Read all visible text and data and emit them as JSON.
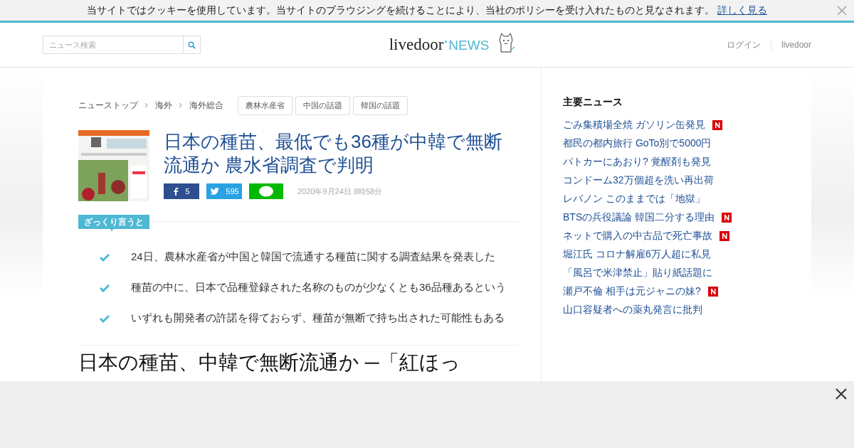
{
  "cookie_bar": {
    "message": "当サイトではクッキーを使用しています。当サイトのブラウジングを続けることにより、当社のポリシーを受け入れたものと見なされます。",
    "link": "詳しく見る"
  },
  "header": {
    "search": {
      "placeholder": "ニュース検索"
    },
    "logo": {
      "brand": "livedoor",
      "product": "NEWS"
    },
    "nav": [
      "ログイン",
      "livedoor"
    ]
  },
  "breadcrumb": [
    "ニューストップ",
    "海外",
    "海外総合"
  ],
  "tags": [
    "農林水産省",
    "中国の話題",
    "韓国の話題"
  ],
  "article": {
    "title": "日本の種苗、最低でも36種が中韓で無断流通か 農水省調査で判明",
    "shares": [
      {
        "kind": "facebook",
        "count": "5"
      },
      {
        "kind": "twitter",
        "count": "595"
      },
      {
        "kind": "line"
      }
    ],
    "date": "2020年9月24日 8時58分",
    "summary_label": "ざっくり言うと",
    "summary": [
      "24日、農林水産省が中国と韓国で流通する種苗に関する調査結果を発表した",
      "種苗の中に、日本で品種登録された名称のものが少なくとも36品種あるという",
      "いずれも開発者の許諾を得ておらず、種苗が無断で持ち出された可能性もある"
    ],
    "heading": "日本の種苗、中韓で無断流通か ─「紅ほっ"
  },
  "sidebar": {
    "title": "主要ニュース",
    "items": [
      {
        "text": "ごみ集積場全焼 ガソリン缶発見",
        "new": true
      },
      {
        "text": "都民の都内旅行 GoTo別で5000円",
        "new": false
      },
      {
        "text": "パトカーにあおり? 覚醒剤も発見",
        "new": false
      },
      {
        "text": "コンドーム32万個超を洗い再出荷",
        "new": false
      },
      {
        "text": "レバノン このままでは「地獄」",
        "new": false
      },
      {
        "text": "BTSの兵役議論 韓国二分する理由",
        "new": true
      },
      {
        "text": "ネットで購入の中古品で死亡事故",
        "new": true
      },
      {
        "text": "堀江氏 コロナ解雇6万人超に私見",
        "new": false
      },
      {
        "text": "「風呂で米津禁止」貼り紙話題に",
        "new": false
      },
      {
        "text": "瀬戸不倫 相手は元ジャニの妹?",
        "new": true
      },
      {
        "text": "山口容疑者への薬丸発言に批判",
        "new": false
      }
    ]
  },
  "ad_overlay": {
    "visible": true
  }
}
